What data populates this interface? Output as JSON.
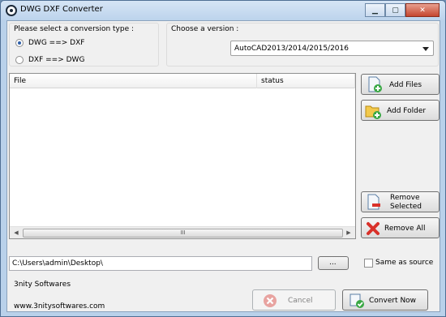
{
  "window": {
    "title": "DWG DXF Converter"
  },
  "conversion": {
    "label": "Please select a conversion type :",
    "option1": "DWG ==> DXF",
    "option2": "DXF ==> DWG"
  },
  "version": {
    "label": "Choose a version :",
    "selected": "AutoCAD2013/2014/2015/2016"
  },
  "file_list": {
    "columns": [
      "File",
      "status"
    ],
    "scroll_thumb": "III"
  },
  "buttons": {
    "add_files": "Add Files",
    "add_folder": "Add Folder",
    "remove_selected_1": "Remove",
    "remove_selected_2": "Selected",
    "remove_all": "Remove All",
    "browse": "...",
    "cancel": "Cancel",
    "convert": "Convert Now"
  },
  "output": {
    "path": "C:\\Users\\admin\\Desktop\\",
    "same_as_source": "Same as source"
  },
  "footer": {
    "company": "3nity Softwares",
    "website": "www.3nitysoftwares.com"
  },
  "colors": {
    "accent": "#2d5ea8",
    "remove_red": "#d9312a",
    "add_green": "#3aa845"
  }
}
